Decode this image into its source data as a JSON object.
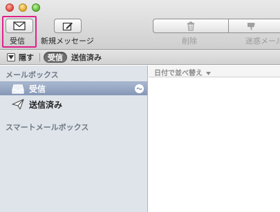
{
  "toolbar": {
    "inbox_label": "受信",
    "new_message_label": "新規メッセージ",
    "delete_label": "削除",
    "junk_label": "迷惑メール"
  },
  "filter_bar": {
    "hide_label": "隠す",
    "inbox_pill": "受信",
    "sent_label": "送信済み"
  },
  "sidebar": {
    "mailboxes_header": "メールボックス",
    "items": [
      {
        "label": "受信",
        "icon": "inbox-tray-icon",
        "selected": true
      },
      {
        "label": "送信済み",
        "icon": "paper-plane-icon",
        "selected": false
      }
    ],
    "smart_mailboxes_header": "スマートメールボックス"
  },
  "message_list": {
    "sort_label": "日付で並べ替え",
    "sort_icon": "sort-down-icon"
  },
  "colors": {
    "focus_ring": "#e0208a",
    "sidebar_bg": "#dfe4ea",
    "selection": "#8597b7"
  }
}
